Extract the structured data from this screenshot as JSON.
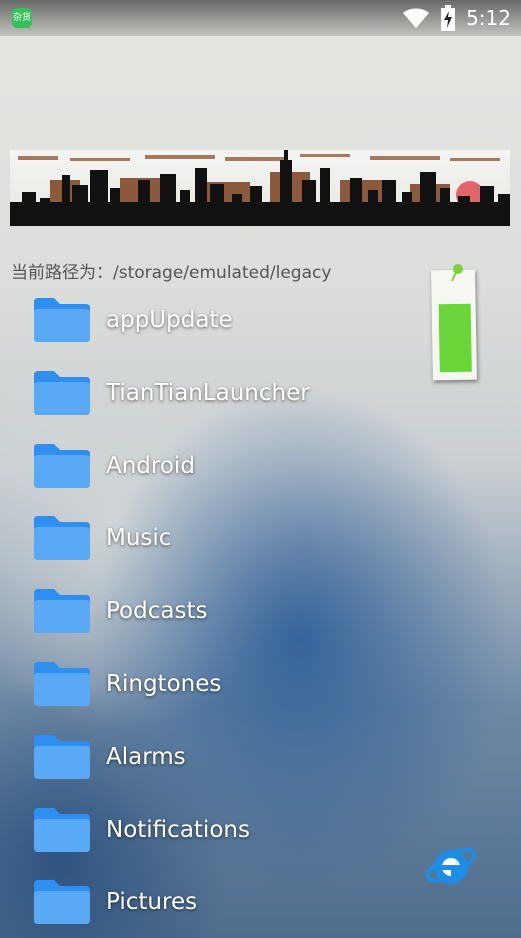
{
  "status_bar": {
    "app_icon_text": "杂货",
    "time": "5:12",
    "icons": [
      "wifi-icon",
      "battery-charging-icon"
    ]
  },
  "path": {
    "label": "当前路径为：/storage/emulated/legacy"
  },
  "folders": [
    {
      "name": "appUpdate"
    },
    {
      "name": "TianTianLauncher"
    },
    {
      "name": "Android"
    },
    {
      "name": "Music"
    },
    {
      "name": "Podcasts"
    },
    {
      "name": "Ringtones"
    },
    {
      "name": "Alarms"
    },
    {
      "name": "Notifications"
    },
    {
      "name": "Pictures"
    }
  ],
  "battery_widget": {
    "level_fraction": 0.72,
    "fill_color": "#6ad63a"
  },
  "colors": {
    "folder_blue": "#2f8ff0",
    "folder_blue_light": "#5aa9f5"
  },
  "browser_icon": "ie-browser-icon"
}
